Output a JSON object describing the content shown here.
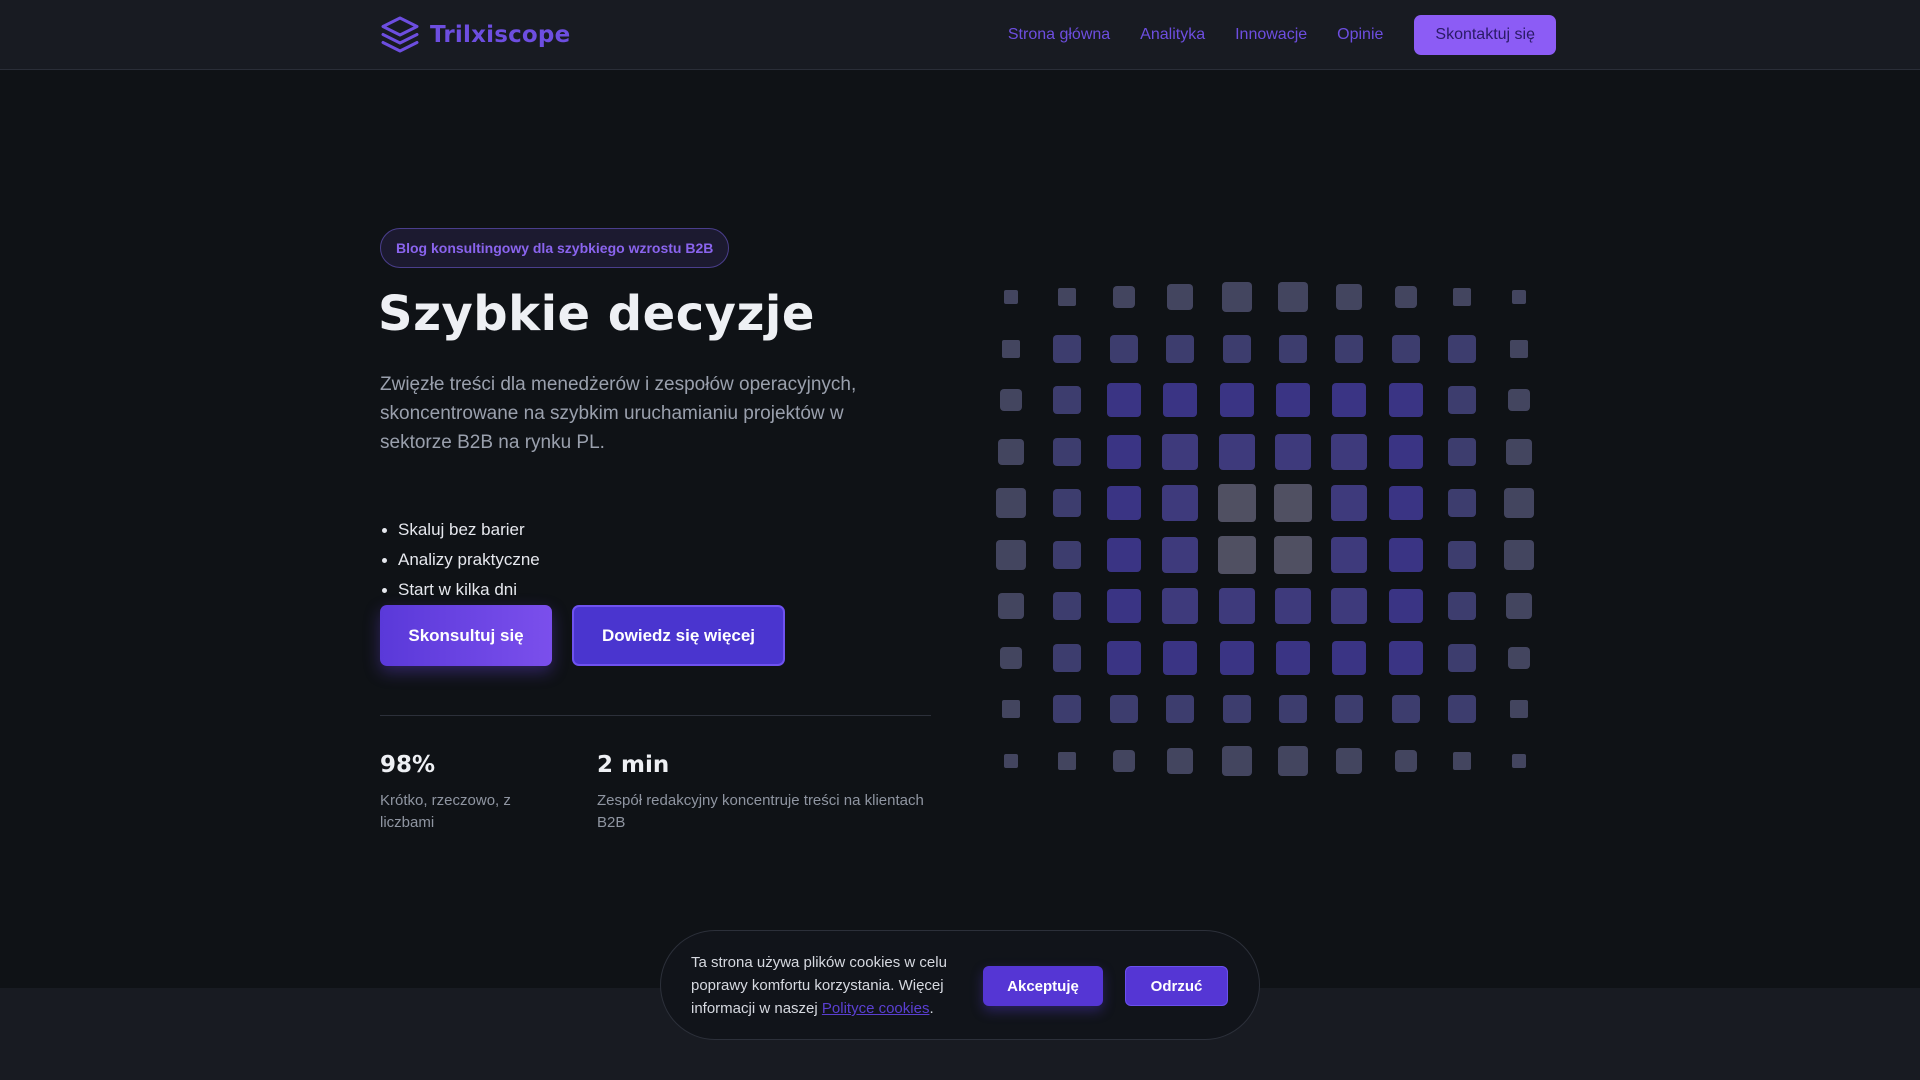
{
  "brand": {
    "name": "Trilxiscope",
    "accent": "#6d4ee0",
    "logo_icon": "stacked-layers-icon"
  },
  "nav": {
    "items": [
      "Strona główna",
      "Analityka",
      "Innowacje",
      "Opinie"
    ],
    "cta": "Skontaktuj się"
  },
  "hero": {
    "badge": "Blog konsultingowy dla szybkiego wzrostu B2B",
    "title": "Szybkie decyzje",
    "lead": "Zwięzłe treści dla menedżerów i zespołów operacyjnych, skoncentrowane na szybkim uruchamianiu projektów w sektorze B2B na rynku PL.",
    "bullets": [
      "Skaluj bez barier",
      "Analizy praktyczne",
      "Start w kilka dni"
    ],
    "primary_button": "Skonsultuj się",
    "secondary_button": "Dowiedz się więcej"
  },
  "stats": [
    {
      "value": "98%",
      "label": "Krótko, rzeczowo, z liczbami"
    },
    {
      "value": "2 min",
      "label": "Zespół redakcyjny koncentruje treści na klientach B2B"
    }
  ],
  "cookie": {
    "text": "Ta strona używa plików cookies w celu poprawy komfortu korzystania. Więcej informacji w naszej ",
    "link": "Polityce cookies",
    "suffix": ".",
    "accept": "Akceptuję",
    "reject": "Odrzuć"
  }
}
